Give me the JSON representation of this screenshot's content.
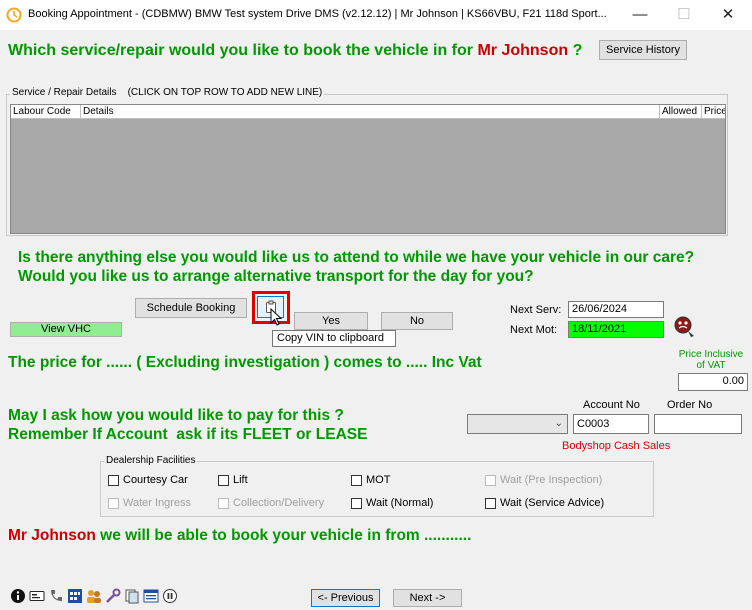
{
  "window": {
    "title": "Booking Appointment - (CDBMW) BMW Test system Drive DMS (v2.12.12) | Mr Johnson | KS66VBU, F21 118d Sport...",
    "minimize": "—",
    "maximize": "☐",
    "close": "✕"
  },
  "header": {
    "question_prefix": "Which service/repair would you like to book the vehicle in for",
    "customer_name": "Mr Johnson",
    "question_suffix": "?",
    "service_history_label": "Service History"
  },
  "repair_grid": {
    "legend": "Service / Repair Details    (CLICK ON TOP ROW TO ADD NEW LINE)",
    "columns": [
      "Labour Code",
      "Details",
      "Allowed",
      "Price"
    ]
  },
  "questions": {
    "line1": "Is there anything else you would like us to attend to while we have your vehicle in our care?",
    "line2": "Would you like us to arrange alternative transport for the day for you?"
  },
  "actions": {
    "schedule_booking": "Schedule Booking",
    "view_vhc": "View VHC",
    "yes": "Yes",
    "no": "No",
    "tooltip": "Copy VIN to clipboard"
  },
  "dates": {
    "next_serv_label": "Next Serv:",
    "next_serv_value": "26/06/2024",
    "next_mot_label": "Next Mot:",
    "next_mot_value": "18/11/2021",
    "mot_bg_color": "#00ff00"
  },
  "price": {
    "sentence": "The price for ...... ( Excluding investigation ) comes to ..... Inc Vat",
    "inclusive_label_1": "Price Inclusive",
    "inclusive_label_2": "of VAT",
    "value": "0.00"
  },
  "payment": {
    "line1": "May I ask how you would like to pay for this ?",
    "line2": "Remember If Account  ask if its FLEET or LEASE",
    "account_no_label": "Account No",
    "order_no_label": "Order No",
    "account_no_value": "C0003",
    "order_no_value": "",
    "account_name": "Bodyshop Cash Sales"
  },
  "facilities": {
    "legend": "Dealership Facilities",
    "items": [
      {
        "label": "Courtesy Car",
        "enabled": true
      },
      {
        "label": "Lift",
        "enabled": true
      },
      {
        "label": "MOT",
        "enabled": true
      },
      {
        "label": "Wait (Pre Inspection)",
        "enabled": false
      },
      {
        "label": "Water Ingress",
        "enabled": false
      },
      {
        "label": "Collection/Delivery",
        "enabled": false
      },
      {
        "label": "Wait (Normal)",
        "enabled": true
      },
      {
        "label": "Wait (Service Advice)",
        "enabled": true
      }
    ]
  },
  "footer": {
    "customer_name": "Mr Johnson",
    "sentence": "we will be able to book your vehicle in from ...........",
    "previous": "<- Previous",
    "next": "Next ->"
  }
}
